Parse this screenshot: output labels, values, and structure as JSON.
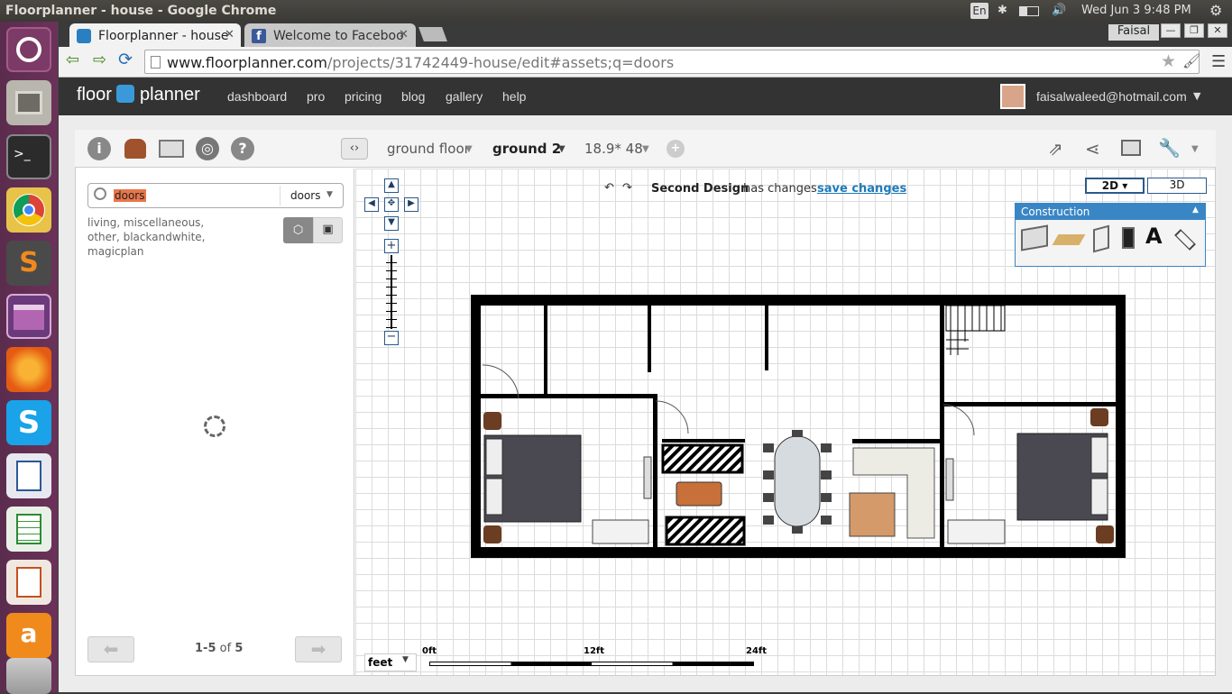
{
  "os": {
    "window_title": "Floorplanner - house - Google Chrome",
    "lang": "En",
    "clock": "Wed Jun  3  9:48 PM"
  },
  "browser": {
    "tabs": [
      {
        "label": "Floorplanner - house"
      },
      {
        "label": "Welcome to Faceboo"
      }
    ],
    "user": "Faisal",
    "url_host": "www.floorplanner.com",
    "url_path": "/projects/31742449-house/edit#assets;q=doors"
  },
  "app": {
    "logo_left": "floor",
    "logo_right": "planner",
    "nav": [
      "dashboard",
      "pro",
      "pricing",
      "blog",
      "gallery",
      "help"
    ],
    "account": "faisalwaleed@hotmail.com"
  },
  "toolbar": {
    "floor_1": "ground floor",
    "floor_2": "ground 2",
    "dimensions": "18.9* 48"
  },
  "search": {
    "query": "doors",
    "category": "doors",
    "tags": "living, miscellaneous, other, blackandwhite, magicplan",
    "pagination_prefix": "1-5",
    "pagination_of": "of",
    "pagination_total": "5"
  },
  "canvas": {
    "design_name": "Second Design",
    "changes_text": "has changes",
    "save_label": "save changes",
    "mode_2d": "2D",
    "mode_3d": "3D",
    "construction_title": "Construction",
    "construction_text_tool": "A",
    "unit": "feet",
    "scale": [
      "0ft",
      "12ft",
      "24ft"
    ]
  },
  "colors": {
    "accent": "#2a7fc0",
    "panel_blue": "#3a86c5",
    "link": "#1f7ab8"
  }
}
